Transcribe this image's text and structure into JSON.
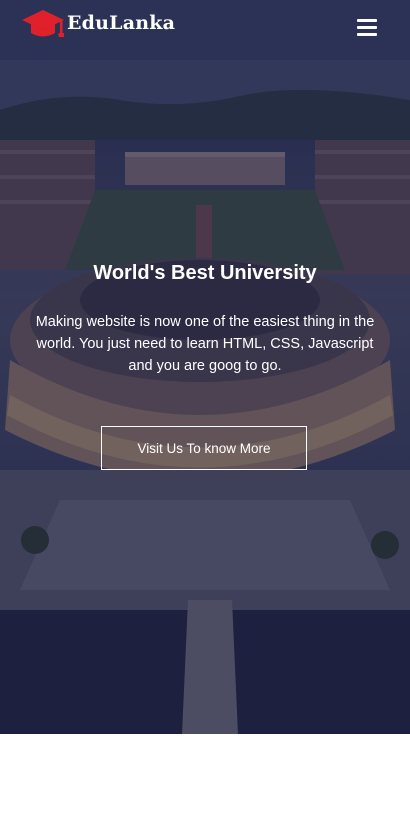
{
  "navbar": {
    "brand": "EduLanka",
    "logo_icon": "graduation-cap-icon",
    "menu_icon": "hamburger-menu-icon"
  },
  "hero": {
    "title": "World's Best University",
    "description": "Making website is now one of the easiest thing in the world. You just need to learn HTML, CSS, Javascript and you are goog to go.",
    "cta_label": "Visit Us To know More"
  },
  "colors": {
    "brand_icon": "#e0202a",
    "overlay": "#14183c",
    "text": "#ffffff",
    "page_background": "#ffffff"
  }
}
